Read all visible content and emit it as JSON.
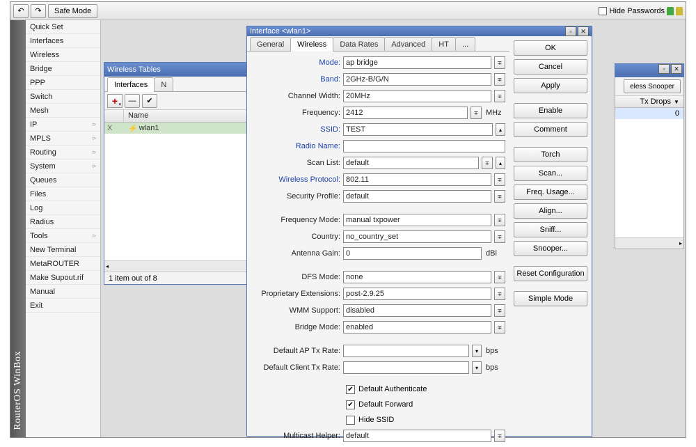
{
  "toolbar": {
    "safe_mode": "Safe Mode",
    "hide_passwords": "Hide Passwords"
  },
  "sidebar_title": "RouterOS WinBox",
  "menu": {
    "items": [
      {
        "label": "Quick Set",
        "arrow": false
      },
      {
        "label": "Interfaces",
        "arrow": false
      },
      {
        "label": "Wireless",
        "arrow": false
      },
      {
        "label": "Bridge",
        "arrow": false
      },
      {
        "label": "PPP",
        "arrow": false
      },
      {
        "label": "Switch",
        "arrow": false
      },
      {
        "label": "Mesh",
        "arrow": false
      },
      {
        "label": "IP",
        "arrow": true
      },
      {
        "label": "MPLS",
        "arrow": true
      },
      {
        "label": "Routing",
        "arrow": true
      },
      {
        "label": "System",
        "arrow": true
      },
      {
        "label": "Queues",
        "arrow": false
      },
      {
        "label": "Files",
        "arrow": false
      },
      {
        "label": "Log",
        "arrow": false
      },
      {
        "label": "Radius",
        "arrow": false
      },
      {
        "label": "Tools",
        "arrow": true
      },
      {
        "label": "New Terminal",
        "arrow": false
      },
      {
        "label": "MetaROUTER",
        "arrow": false
      },
      {
        "label": "Make Supout.rif",
        "arrow": false
      },
      {
        "label": "Manual",
        "arrow": false
      },
      {
        "label": "Exit",
        "arrow": false
      }
    ]
  },
  "wireless_tables": {
    "title": "Wireless Tables",
    "tabs": [
      "Interfaces",
      "N"
    ],
    "col1": "Name",
    "row_flag": "X",
    "row_name": "wlan1",
    "status": "1 item out of 8"
  },
  "right": {
    "snooper_btn": "eless Snooper",
    "tx_drops": "Tx Drops",
    "tx_drops_val": "0"
  },
  "dialog": {
    "title": "Interface <wlan1>",
    "tabs": [
      "General",
      "Wireless",
      "Data Rates",
      "Advanced",
      "HT",
      "..."
    ],
    "active_tab": 1,
    "buttons": [
      "OK",
      "Cancel",
      "Apply",
      "Enable",
      "Comment",
      "Torch",
      "Scan...",
      "Freq. Usage...",
      "Align...",
      "Sniff...",
      "Snooper...",
      "Reset Configuration",
      "Simple Mode"
    ],
    "fields": {
      "mode_label": "Mode:",
      "mode": "ap bridge",
      "band_label": "Band:",
      "band": "2GHz-B/G/N",
      "channel_width_label": "Channel Width:",
      "channel_width": "20MHz",
      "frequency_label": "Frequency:",
      "frequency": "2412",
      "frequency_unit": "MHz",
      "ssid_label": "SSID:",
      "ssid": "TEST",
      "radio_name_label": "Radio Name:",
      "radio_name": "",
      "scan_list_label": "Scan List:",
      "scan_list": "default",
      "wireless_protocol_label": "Wireless Protocol:",
      "wireless_protocol": "802.11",
      "security_profile_label": "Security Profile:",
      "security_profile": "default",
      "frequency_mode_label": "Frequency Mode:",
      "frequency_mode": "manual txpower",
      "country_label": "Country:",
      "country": "no_country_set",
      "antenna_gain_label": "Antenna Gain:",
      "antenna_gain": "0",
      "antenna_gain_unit": "dBi",
      "dfs_mode_label": "DFS Mode:",
      "dfs_mode": "none",
      "proprietary_ext_label": "Proprietary Extensions:",
      "proprietary_ext": "post-2.9.25",
      "wmm_support_label": "WMM Support:",
      "wmm_support": "disabled",
      "bridge_mode_label": "Bridge Mode:",
      "bridge_mode": "enabled",
      "default_ap_tx_label": "Default AP Tx Rate:",
      "default_ap_tx": "",
      "bps1": "bps",
      "default_client_tx_label": "Default Client Tx Rate:",
      "default_client_tx": "",
      "bps2": "bps",
      "default_authenticate": "Default Authenticate",
      "default_forward": "Default Forward",
      "hide_ssid": "Hide SSID",
      "multicast_helper_label": "Multicast Helper:",
      "multicast_helper": "default"
    }
  }
}
